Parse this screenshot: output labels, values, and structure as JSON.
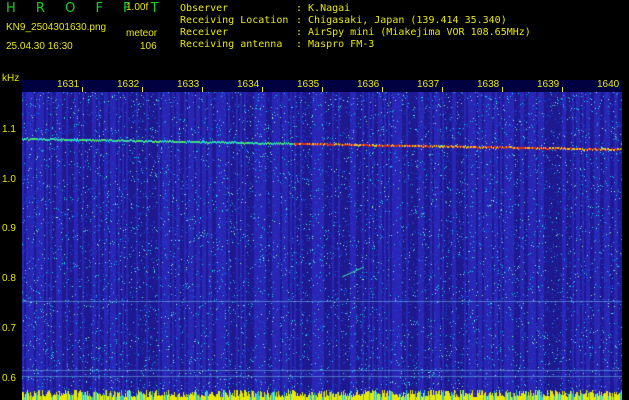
{
  "header": {
    "title": "H R O F F T",
    "version": "1.00f",
    "filename": "KN9_2504301630.png",
    "mode": "meteor",
    "datetime": "25.04.30 16:30",
    "count": "106"
  },
  "info": [
    {
      "label": "Observer",
      "value": ": K.Nagai"
    },
    {
      "label": "Receiving Location",
      "value": ": Chigasaki, Japan (139.414 35.340)"
    },
    {
      "label": "Receiver",
      "value": ": AirSpy mini (Miakejima VOR 108.65MHz)"
    },
    {
      "label": "Receiving antenna",
      "value": ": Maspro FM-3"
    }
  ],
  "spectrogram": {
    "frequency_unit": "kHz",
    "frequency_ticks": [
      "1.1",
      "1.0",
      "0.9",
      "0.8",
      "0.7",
      "0.6"
    ],
    "time_ticks": [
      "1631",
      "1632",
      "1633",
      "1634",
      "1635",
      "1636",
      "1637",
      "1638",
      "1639",
      "1640"
    ],
    "colors": {
      "background": "#2020b0",
      "noise": "#20c8e0",
      "signal": "#e03020",
      "baseline": "#e8e800"
    }
  }
}
